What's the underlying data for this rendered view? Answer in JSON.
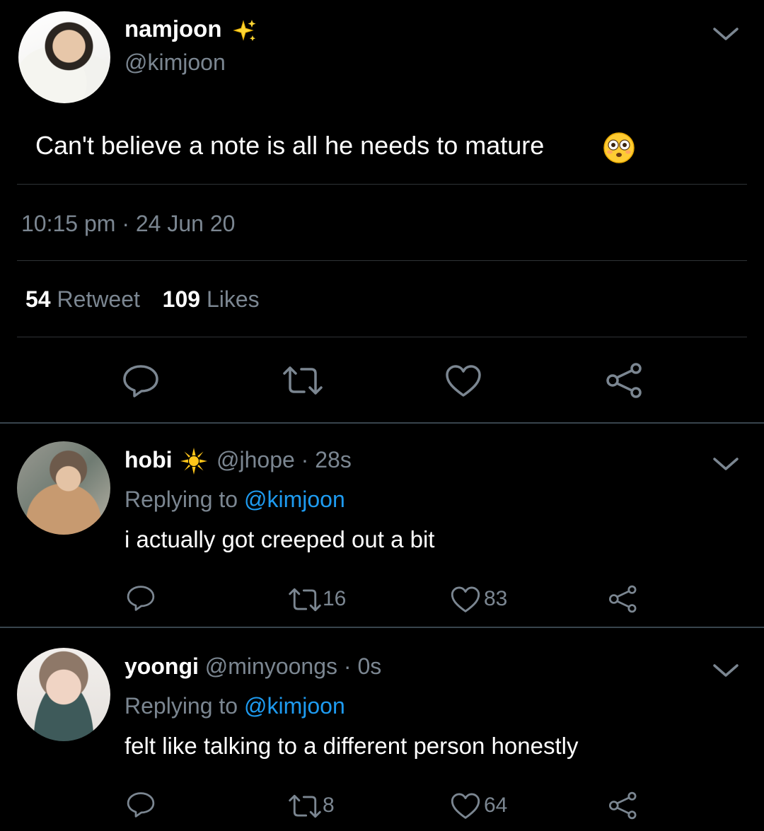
{
  "main_tweet": {
    "display_name": "namjoon",
    "handle": "@kimjoon",
    "text": "Can't believe a note is all he needs to mature",
    "time": "10:15 pm",
    "date_sep": "·",
    "date": "24 Jun 20",
    "retweet_count": "54",
    "retweet_label": "Retweet",
    "like_count": "109",
    "like_label": "Likes",
    "name_badge_icon": "sparkles-icon",
    "emoji_icon": "flushed-face-icon"
  },
  "replies": [
    {
      "display_name": "hobi",
      "handle_time": "@jhope · 28s",
      "replying_prefix": "Replying to",
      "replying_handle": "@kimjoon",
      "text": "i actually got creeped out a bit",
      "retweets": "16",
      "likes": "83",
      "name_badge_icon": "sun-icon"
    },
    {
      "display_name": "yoongi",
      "handle_time": "@minyoongs · 0s",
      "replying_prefix": "Replying to",
      "replying_handle": "@kimjoon",
      "text": "felt like talking to a different person honestly",
      "retweets": "8",
      "likes": "64"
    }
  ],
  "colors": {
    "background": "#000000",
    "muted": "#7b8691",
    "link": "#1e9bf0",
    "divider": "#2f3336"
  }
}
